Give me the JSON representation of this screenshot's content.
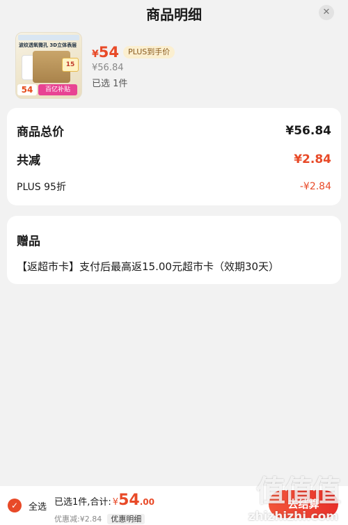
{
  "header": {
    "title": "商品明细",
    "close_icon": "close-icon"
  },
  "product": {
    "thumb": {
      "promo_line": "波纹透氧微孔 3D立体表层",
      "badge": "15",
      "price_tag": "54",
      "subsidy": "百亿补贴"
    },
    "price_symbol": "¥",
    "price": "54",
    "plus_tag": "PLUS到手价",
    "original_price": "¥56.84",
    "selected_count": "已选 1件"
  },
  "summary": {
    "total_label": "商品总价",
    "total_value": "¥56.84",
    "reduce_label": "共减",
    "reduce_value": "¥2.84",
    "plus_label": "PLUS 95折",
    "plus_value": "-¥2.84"
  },
  "gift": {
    "title": "赠品",
    "text": "【返超市卡】支付后最高返15.00元超市卡（效期30天）"
  },
  "bottom_bar": {
    "select_all": "全选",
    "selected_total_label": "已选1件,合计:",
    "currency": "¥",
    "total_int": "54",
    "total_dec": ".00",
    "discount": "优惠减:¥2.84",
    "detail_chip": "优惠明细",
    "checkout_label": "去结算"
  },
  "watermark": {
    "logo": "值值值",
    "url": "zhizhizhi.com"
  },
  "colors": {
    "accent": "#e84a28",
    "plus_tag_bg": "#fbefd0",
    "background": "#f2f2f2"
  }
}
